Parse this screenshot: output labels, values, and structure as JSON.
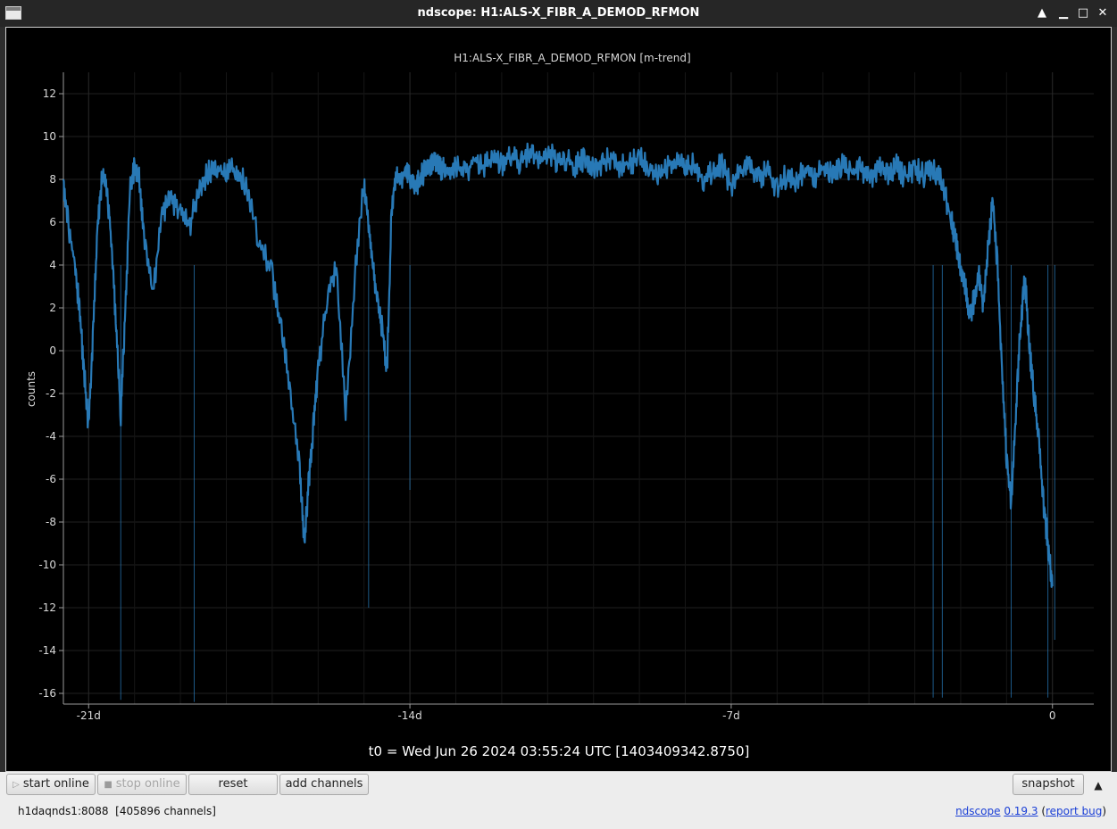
{
  "window": {
    "title": "ndscope: H1:ALS-X_FIBR_A_DEMOD_RFMON"
  },
  "plot": {
    "title": "H1:ALS-X_FIBR_A_DEMOD_RFMON [m-trend]",
    "ylabel": "counts",
    "t0_label": "t0 = Wed Jun 26 2024 03:55:24 UTC [1403409342.8750]",
    "line_color": "#2a7fc0"
  },
  "chart_data": {
    "type": "line",
    "title": "H1:ALS-X_FIBR_A_DEMOD_RFMON [m-trend]",
    "ylabel": "counts",
    "xlim": [
      -21.55,
      0.9
    ],
    "ylim": [
      -16.5,
      13
    ],
    "x_ticks": [
      -21,
      -14,
      -7,
      0
    ],
    "x_tick_labels": [
      "-21d",
      "-14d",
      "-7d",
      "0"
    ],
    "y_ticks": [
      12,
      10,
      8,
      6,
      4,
      2,
      0,
      -2,
      -4,
      -6,
      -8,
      -10,
      -12,
      -14,
      -16
    ],
    "grid": true,
    "series": [
      {
        "x": [
          -21.55,
          -21.45,
          -21.3,
          -21.2,
          -21.1,
          -21.0,
          -20.9,
          -20.8,
          -20.7,
          -20.6,
          -20.5,
          -20.4,
          -20.3,
          -20.2,
          -20.1,
          -20.0,
          -19.9,
          -19.8,
          -19.6,
          -19.4,
          -19.2,
          -19.0,
          -18.8,
          -18.6,
          -18.4,
          -18.2,
          -18.0,
          -17.8,
          -17.6,
          -17.3,
          -17.0,
          -16.8,
          -16.6,
          -16.4,
          -16.3,
          -16.2,
          -16.1,
          -16.0,
          -15.8,
          -15.6,
          -15.4,
          -15.2,
          -15.0,
          -14.9,
          -14.8,
          -14.7,
          -14.6,
          -14.5,
          -14.4,
          -14.3,
          -14.2,
          -14.1,
          -14.0,
          -13.9,
          -13.8,
          -13.7,
          -13.6,
          -13.5,
          -13.4,
          -13.3,
          -13.2,
          -13.0,
          -12.8,
          -12.6,
          -12.4,
          -12.2,
          -12.0,
          -11.8,
          -11.6,
          -11.4,
          -11.2,
          -11.0,
          -10.8,
          -10.6,
          -10.4,
          -10.2,
          -10.0,
          -9.8,
          -9.6,
          -9.4,
          -9.2,
          -9.0,
          -8.8,
          -8.6,
          -8.4,
          -8.2,
          -8.0,
          -7.8,
          -7.6,
          -7.4,
          -7.2,
          -7.0,
          -6.8,
          -6.6,
          -6.4,
          -6.2,
          -6.0,
          -5.8,
          -5.6,
          -5.4,
          -5.2,
          -5.0,
          -4.8,
          -4.6,
          -4.4,
          -4.2,
          -4.0,
          -3.8,
          -3.6,
          -3.4,
          -3.2,
          -3.0,
          -2.8,
          -2.6,
          -2.4,
          -2.2,
          -2.1,
          -2.0,
          -1.9,
          -1.8,
          -1.7,
          -1.6,
          -1.5,
          -1.4,
          -1.3,
          -1.2,
          -1.1,
          -1.0,
          -0.9,
          -0.8,
          -0.7,
          -0.6,
          -0.5,
          -0.4,
          -0.3,
          -0.2,
          -0.1,
          0.0
        ],
        "y": [
          8.0,
          6.0,
          4.0,
          2.0,
          -1.0,
          -3.5,
          1.0,
          6.0,
          8.3,
          7.5,
          5.0,
          1.0,
          -3.0,
          2.0,
          7.5,
          8.5,
          8.0,
          5.5,
          2.5,
          6.5,
          7.0,
          6.5,
          5.8,
          7.5,
          8.3,
          8.5,
          8.2,
          8.6,
          7.8,
          5.2,
          3.5,
          1.0,
          -2.0,
          -5.5,
          -9.0,
          -6.0,
          -3.5,
          -1.0,
          2.5,
          4.0,
          -3.0,
          3.5,
          7.8,
          6.0,
          4.0,
          2.0,
          1.0,
          -1.0,
          6.5,
          8.2,
          7.8,
          8.5,
          8.0,
          7.6,
          8.0,
          8.3,
          8.7,
          8.9,
          8.8,
          8.5,
          8.2,
          8.6,
          8.3,
          8.9,
          8.6,
          9.0,
          8.7,
          9.1,
          8.8,
          9.2,
          8.9,
          9.3,
          8.9,
          9.0,
          8.6,
          9.0,
          8.5,
          8.8,
          9.0,
          8.6,
          8.8,
          9.0,
          8.7,
          8.2,
          8.6,
          8.9,
          8.5,
          8.7,
          7.8,
          8.4,
          8.7,
          7.6,
          8.3,
          8.6,
          8.1,
          8.4,
          7.5,
          8.2,
          8.0,
          8.4,
          8.1,
          8.6,
          8.4,
          8.7,
          8.2,
          8.5,
          8.0,
          8.5,
          8.3,
          8.6,
          8.1,
          8.5,
          8.2,
          8.6,
          7.8,
          6.0,
          5.0,
          4.0,
          3.0,
          1.5,
          2.5,
          3.5,
          2.0,
          5.0,
          7.0,
          4.0,
          -1.0,
          -5.0,
          -7.0,
          -3.0,
          1.0,
          3.5,
          0.0,
          -2.0,
          -4.0,
          -7.0,
          -9.0,
          -11.0
        ]
      }
    ]
  },
  "toolbar": {
    "start_online": "start online",
    "stop_online": "stop online",
    "reset": "reset",
    "add_channels": "add channels",
    "snapshot": "snapshot"
  },
  "status": {
    "server": "h1daqnds1:8088",
    "channels": "[405896 channels]"
  },
  "links": {
    "ndscope": "ndscope",
    "version": "0.19.3",
    "report_bug": "report bug"
  }
}
